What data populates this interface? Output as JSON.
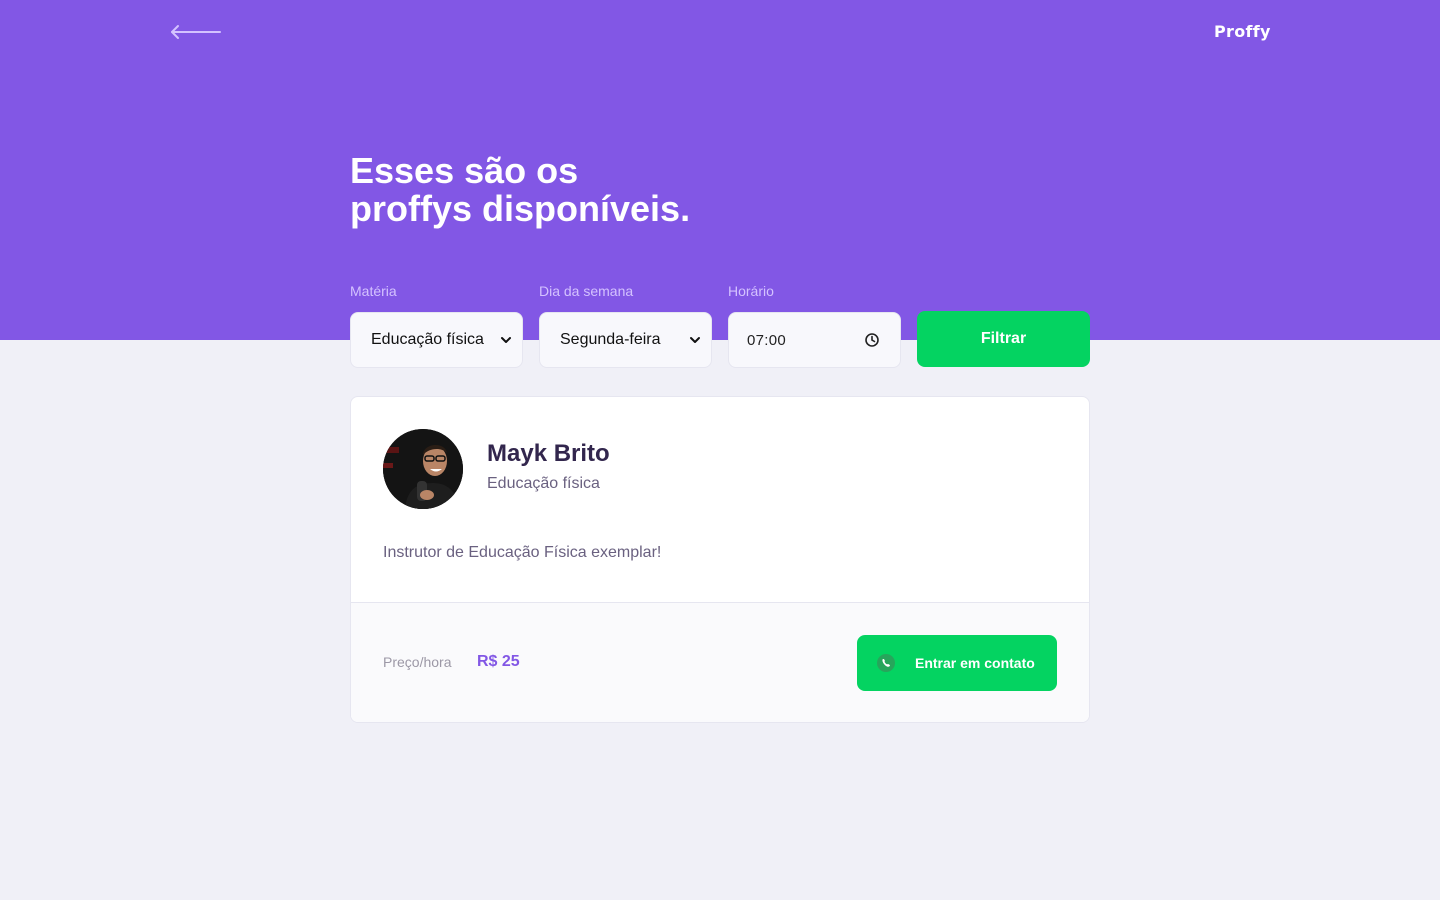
{
  "header": {
    "back_icon": "arrow-left-icon",
    "logo": "Proffy",
    "title_line1": "Esses são os",
    "title_line2": "proffys disponíveis."
  },
  "filters": {
    "subject_label": "Matéria",
    "subject_value": "Educação física",
    "weekday_label": "Dia da semana",
    "weekday_value": "Segunda-feira",
    "time_label": "Horário",
    "time_value": "07:00",
    "submit_label": "Filtrar"
  },
  "teacher": {
    "name": "Mayk Brito",
    "subject": "Educação física",
    "bio": "Instrutor de Educação Física exemplar!",
    "price_label": "Preço/hora",
    "price_value": "R$ 25",
    "contact_label": "Entrar em contato",
    "contact_icon": "whatsapp-icon"
  },
  "colors": {
    "primary": "#8257E5",
    "secondary": "#04D361",
    "background": "#F0F0F7",
    "title_text": "#32264D",
    "body_text": "#6A6180"
  }
}
